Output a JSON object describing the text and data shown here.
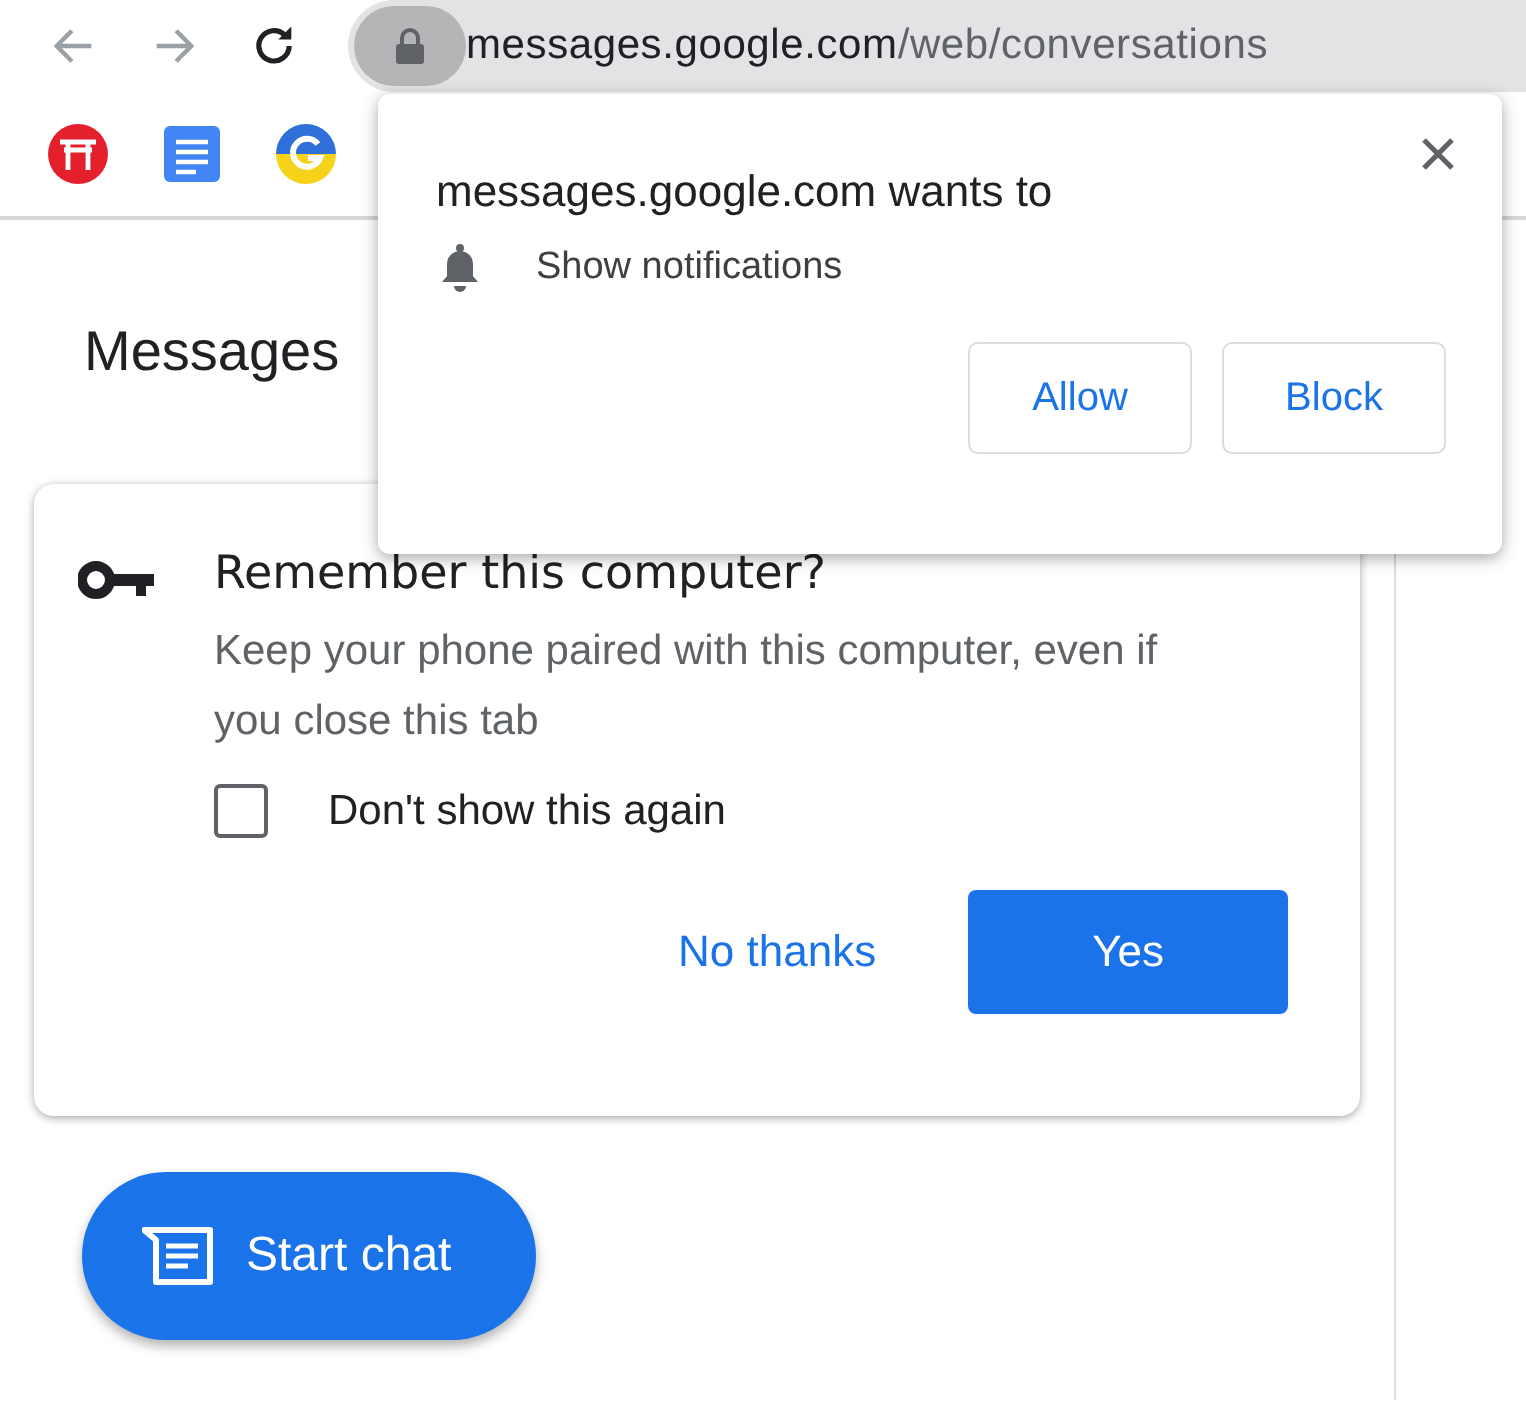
{
  "toolbar": {
    "url_host": "messages.google.com",
    "url_path": "/web/conversations"
  },
  "page": {
    "title": "Messages"
  },
  "remember_card": {
    "title": "Remember this computer?",
    "body": "Keep your phone paired with this computer, even if you close this tab",
    "checkbox": {
      "label": "Don't show this again",
      "checked": false
    },
    "buttons": [
      {
        "label": "No thanks",
        "kind": "text"
      },
      {
        "label": "Yes",
        "kind": "filled"
      }
    ]
  },
  "start_chat": {
    "label": "Start chat"
  },
  "permission_popup": {
    "title": "messages.google.com wants to",
    "permission": "Show notifications",
    "buttons": [
      "Allow",
      "Block"
    ]
  }
}
